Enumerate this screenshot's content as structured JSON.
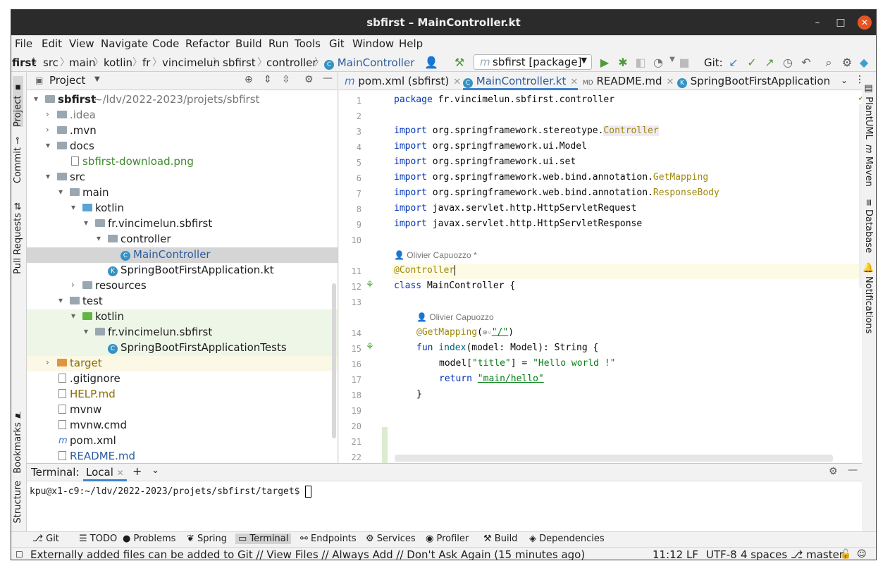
{
  "window": {
    "title": "sbfirst – MainController.kt"
  },
  "menu": [
    "File",
    "Edit",
    "View",
    "Navigate",
    "Code",
    "Refactor",
    "Build",
    "Run",
    "Tools",
    "Git",
    "Window",
    "Help"
  ],
  "breadcrumb": [
    "first",
    "src",
    "main",
    "kotlin",
    "fr",
    "vincimelun",
    "sbfirst",
    "controller",
    "MainController"
  ],
  "toolbar": {
    "run_config": "sbfirst [package]",
    "git_label": "Git:"
  },
  "left_tabs": [
    "Project",
    "Commit",
    "Pull Requests",
    "Bookmarks",
    "Structure"
  ],
  "right_tabs": [
    "PlantUML",
    "Maven",
    "Database",
    "Notifications"
  ],
  "project": {
    "header": "Project",
    "root_name": "sbfirst",
    "root_path": "~/ldv/2022-2023/projets/sbfirst",
    "items": [
      {
        "label": ".idea"
      },
      {
        "label": ".mvn"
      },
      {
        "label": "docs"
      },
      {
        "label": "sbfirst-download.png"
      },
      {
        "label": "src"
      },
      {
        "label": "main"
      },
      {
        "label": "kotlin"
      },
      {
        "label": "fr.vincimelun.sbfirst"
      },
      {
        "label": "controller"
      },
      {
        "label": "MainController"
      },
      {
        "label": "SpringBootFirstApplication.kt"
      },
      {
        "label": "resources"
      },
      {
        "label": "test"
      },
      {
        "label": "kotlin"
      },
      {
        "label": "fr.vincimelun.sbfirst"
      },
      {
        "label": "SpringBootFirstApplicationTests"
      },
      {
        "label": "target"
      },
      {
        "label": ".gitignore"
      },
      {
        "label": "HELP.md"
      },
      {
        "label": "mvnw"
      },
      {
        "label": "mvnw.cmd"
      },
      {
        "label": "pom.xml"
      },
      {
        "label": "README.md"
      }
    ]
  },
  "editor": {
    "tabs": [
      "pom.xml (sbfirst)",
      "MainController.kt",
      "README.md",
      "SpringBootFirstApplication"
    ],
    "line_numbers": [
      "1",
      "2",
      "3",
      "4",
      "5",
      "6",
      "7",
      "8",
      "9",
      "10",
      "11",
      "12",
      "13",
      "14",
      "15",
      "16",
      "17",
      "18",
      "19",
      "20",
      "21",
      "22"
    ],
    "author_hint_1": "Olivier Capuozzo *",
    "author_hint_2": "Olivier Capuozzo",
    "code": {
      "l1_kw": "package",
      "l1_rest": " fr.vincimelun.sbfirst.controller",
      "import_kw": "import",
      "l3_a": " org.springframework.stereotype.",
      "l3_b": "Controller",
      "l4": " org.springframework.ui.Model",
      "l5": " org.springframework.ui.set",
      "l6_a": " org.springframework.web.bind.annotation.",
      "l6_b": "GetMapping",
      "l7_a": " org.springframework.web.bind.annotation.",
      "l7_b": "ResponseBody",
      "l8": " javax.servlet.http.HttpServletRequest",
      "l9": " javax.servlet.http.HttpServletResponse",
      "l11": "@Controller",
      "l12_kw": "class",
      "l12_rest": " MainController {",
      "l14_ann": "@GetMapping",
      "l14_a": "(",
      "l14_icon": "⊕",
      "l14_b": "˅",
      "l14_str": "\"/\"",
      "l14_c": ")",
      "l15_kw": "fun",
      "l15_fn": " index",
      "l15_rest": "(model: Model): String {",
      "l16_a": "model[",
      "l16_s1": "\"title\"",
      "l16_b": "] = ",
      "l16_s2": "\"Hello world !\"",
      "l17_kw": "return",
      "l17_s": "\"main/hello\"",
      "l18": "}"
    }
  },
  "terminal": {
    "label": "Terminal:",
    "tab": "Local",
    "prompt": "kpu@x1-c9:~/ldv/2022-2023/projets/sbfirst/target$"
  },
  "bottom_tools": [
    "Git",
    "TODO",
    "Problems",
    "Spring",
    "Terminal",
    "Endpoints",
    "Services",
    "Profiler",
    "Build",
    "Dependencies"
  ],
  "status": {
    "message": "Externally added files can be added to Git // View Files // Always Add // Don't Ask Again (15 minutes ago)",
    "position": "11:12",
    "line_sep": "LF",
    "encoding": "UTF-8",
    "indent": "4 spaces",
    "branch": "master"
  }
}
